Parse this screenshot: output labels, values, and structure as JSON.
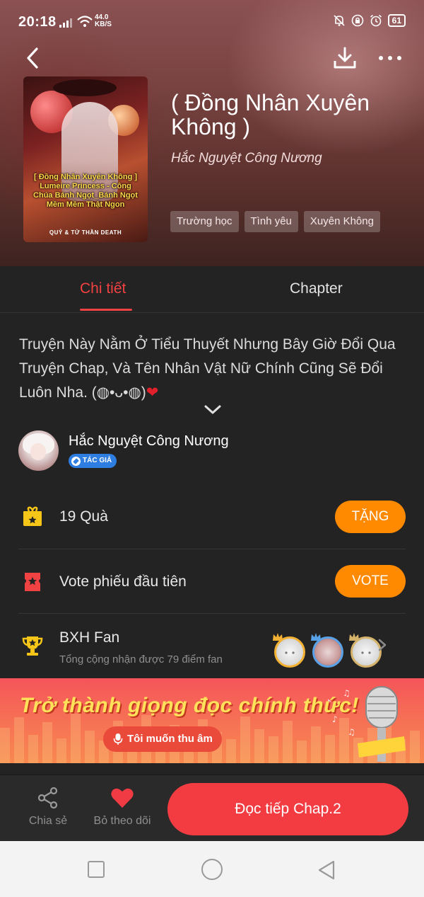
{
  "status_bar": {
    "time": "20:18",
    "net_speed": "44.0",
    "net_unit": "KB/S",
    "battery": "61"
  },
  "book": {
    "title": "( Đồng Nhân Xuyên Không )",
    "author": "Hắc Nguyệt Công Nương",
    "tags": [
      "Trường học",
      "Tình yêu",
      "Xuyên Không"
    ],
    "cover_text": "[ Đồng Nhân Xuyên Không ] Lumeire Princess - Công Chúa Bánh Ngọt_Bánh Ngọt Mềm Mềm Thật Ngon",
    "cover_footer": "QUỶ & TỬ THẦN DEATH"
  },
  "tabs": {
    "detail": "Chi tiết",
    "chapter": "Chapter"
  },
  "description": {
    "text": "Truyện Này Nằm Ở Tiểu Thuyết Nhưng Bây Giờ Đổi Qua Truyện Chap, Và Tên Nhân Vật Nữ Chính Cũng Sẽ Đổi Luôn Nha. (◍•ᴗ•◍)",
    "heart": "❤"
  },
  "author_section": {
    "name": "Hắc Nguyệt Công Nương",
    "badge": "TÁC GIẢ"
  },
  "gift_row": {
    "label": "19  Quà",
    "button": "TẶNG"
  },
  "vote_row": {
    "label": "Vote phiếu đầu tiên",
    "button": "VOTE"
  },
  "fan_row": {
    "label": "BXH Fan",
    "sub": "Tổng cộng nhận được 79 điểm fan"
  },
  "banner": {
    "title": "Trở thành giọng đọc chính thức!",
    "button": "Tôi muốn thu âm"
  },
  "action_bar": {
    "share": "Chia sẻ",
    "unfollow": "Bỏ theo dõi",
    "read": "Đọc tiếp Chap.2"
  },
  "colors": {
    "accent": "#f04242",
    "orange": "#ff8a00",
    "read_button": "#f23c42"
  }
}
